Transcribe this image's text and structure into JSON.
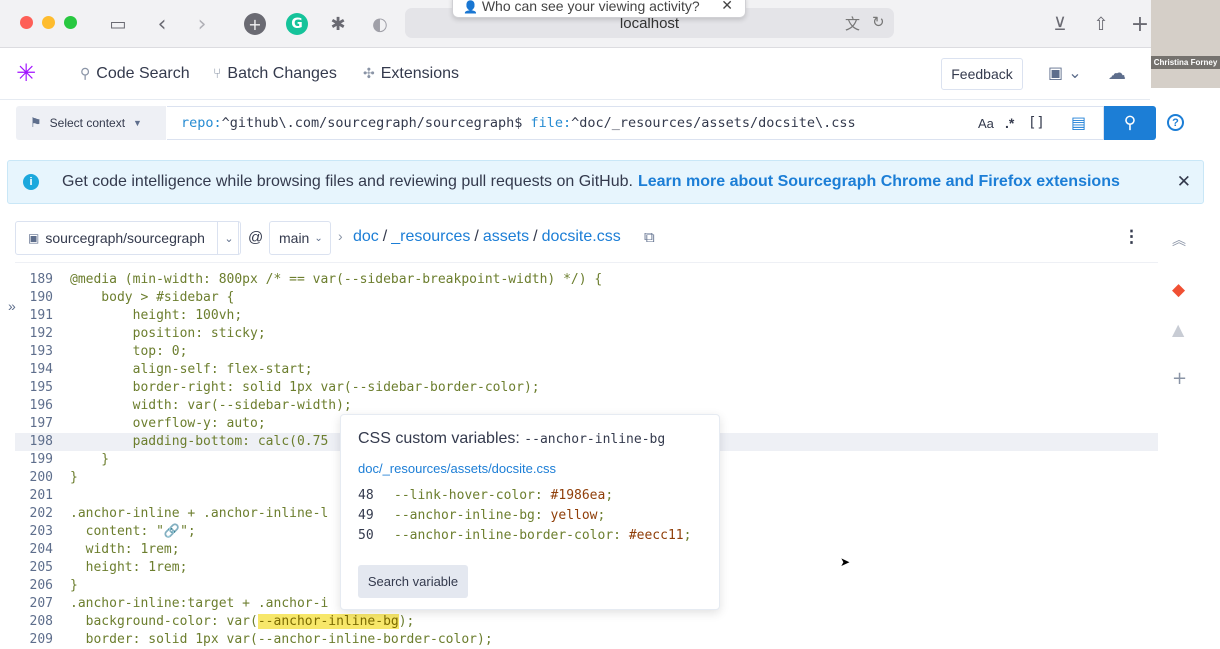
{
  "browser": {
    "url": "localhost",
    "tooltip": "Who can see your viewing activity?",
    "tooltip_close": "✕",
    "video_caption": "Christina Forney",
    "icons": [
      "sidebar-icon",
      "back-icon",
      "forward-icon",
      "add-extension-icon",
      "grammarly-icon",
      "puzzle-icon",
      "shield-icon",
      "translate-icon",
      "reload-icon",
      "download-icon",
      "share-icon",
      "new-tab-icon"
    ]
  },
  "navbar": {
    "code_search": "Code Search",
    "batch_changes": "Batch Changes",
    "extensions": "Extensions",
    "feedback": "Feedback"
  },
  "search": {
    "context_label": "Select context",
    "query_repo_key": "repo:",
    "query_repo_val": "^github\\.com/sourcegraph/sourcegraph$",
    "query_file_key": "file:",
    "query_file_val": "^doc/_resources/assets/docsite\\.css",
    "case_toggle": "Aa",
    "regex_toggle": ".*",
    "structural_toggle": "[]",
    "help": "?"
  },
  "banner": {
    "text": "Get code intelligence while browsing files and reviewing pull requests on GitHub.",
    "link": "Learn more about Sourcegraph Chrome and Firefox extensions",
    "close": "✕"
  },
  "file": {
    "repo": "sourcegraph/sourcegraph",
    "at": "@",
    "branch": "main",
    "path": [
      "doc",
      "_resources",
      "assets",
      "docsite.css"
    ]
  },
  "code_lines": [
    {
      "n": "189",
      "t": "@media (min-width: 800px /* == var(--sidebar-breakpoint-width) */) {"
    },
    {
      "n": "190",
      "t": "    body > #sidebar {"
    },
    {
      "n": "191",
      "t": "        height: 100vh;"
    },
    {
      "n": "192",
      "t": "        position: sticky;"
    },
    {
      "n": "193",
      "t": "        top: 0;"
    },
    {
      "n": "194",
      "t": "        align-self: flex-start;"
    },
    {
      "n": "195",
      "t": "        border-right: solid 1px var(--sidebar-border-color);"
    },
    {
      "n": "196",
      "t": "        width: var(--sidebar-width);"
    },
    {
      "n": "197",
      "t": "        overflow-y: auto;"
    },
    {
      "n": "198",
      "t": "        padding-bottom: calc(0.75"
    },
    {
      "n": "199",
      "t": "    }"
    },
    {
      "n": "200",
      "t": "}"
    },
    {
      "n": "201",
      "t": ""
    },
    {
      "n": "202",
      "t": ".anchor-inline + .anchor-inline-l"
    },
    {
      "n": "203",
      "t": "  content: \"🔗\";"
    },
    {
      "n": "204",
      "t": "  width: 1rem;"
    },
    {
      "n": "205",
      "t": "  height: 1rem;"
    },
    {
      "n": "206",
      "t": "}"
    },
    {
      "n": "207",
      "t": ".anchor-inline:target + .anchor-i"
    },
    {
      "n": "208",
      "t": "  background-color: var(--anchor-inline-bg);"
    },
    {
      "n": "209",
      "t": "  border: solid 1px var(--anchor-inline-border-color);"
    }
  ],
  "popover": {
    "title": "CSS custom variables:",
    "title_var": "--anchor-inline-bg",
    "file_link": "doc/_resources/assets/docsite.css",
    "lines": [
      {
        "n": "48",
        "k": "--link-hover-color:",
        "v": "#1986ea",
        "end": ";"
      },
      {
        "n": "49",
        "k": "--anchor-inline-bg:",
        "v": "yellow",
        "end": ";"
      },
      {
        "n": "50",
        "k": "--anchor-inline-border-color:",
        "v": "#eecc11",
        "end": ";"
      }
    ],
    "button": "Search variable"
  }
}
